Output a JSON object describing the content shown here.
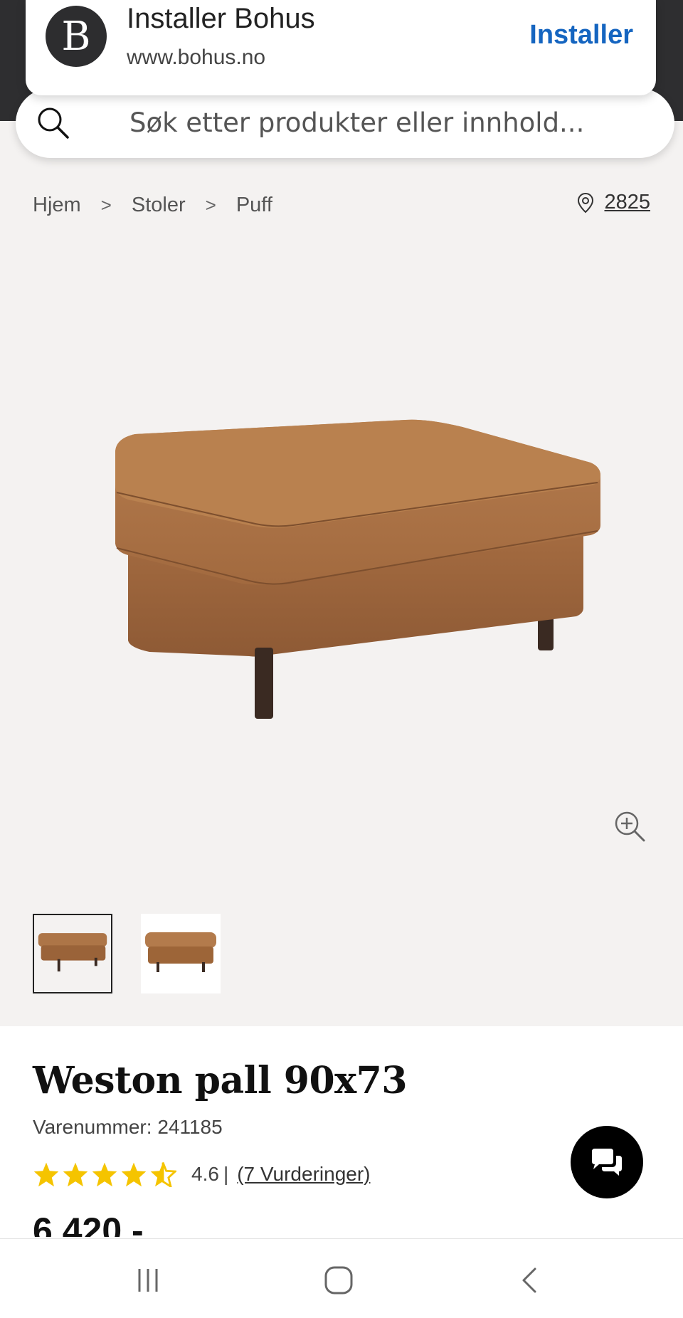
{
  "banner": {
    "logo_letter": "B",
    "title": "Installer Bohus",
    "url": "www.bohus.no",
    "install_label": "Installer"
  },
  "search": {
    "placeholder": "Søk etter produkter eller innhold..."
  },
  "breadcrumb": {
    "items": [
      "Hjem",
      "Stoler",
      "Puff"
    ],
    "separator": ">"
  },
  "location": {
    "postcode": "2825",
    "icon": "map-pin-icon"
  },
  "product": {
    "title": "Weston pall 90x73",
    "sku": "Varenummer: 241185",
    "rating_value": "4.6",
    "rating_divider": "|",
    "reviews_label": "(7 Vurderinger)",
    "stars_count": 4.5,
    "price": "6 420,-",
    "thumbnail_count": 2,
    "selected_thumbnail": 1
  },
  "colors": {
    "accent_link": "#1565c0",
    "star": "#f5c400",
    "leather": "#a86f45",
    "background_gray": "#f4f2f1"
  },
  "system_nav": {
    "icons": [
      "recent-apps-icon",
      "home-icon",
      "back-icon"
    ]
  }
}
